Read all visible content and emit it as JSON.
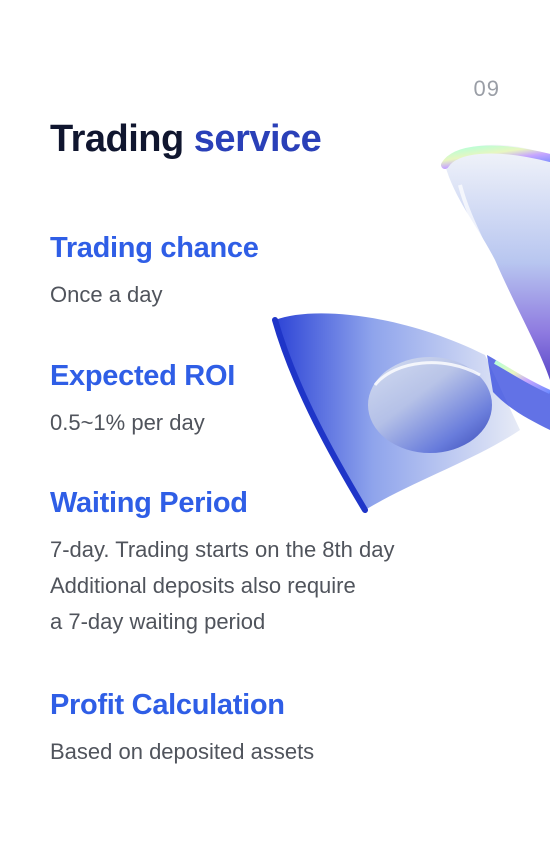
{
  "page_number": "09",
  "title": {
    "main": "Trading",
    "accent": "service"
  },
  "sections": [
    {
      "heading": "Trading chance",
      "lines": [
        "Once a day"
      ]
    },
    {
      "heading": "Expected ROI",
      "lines": [
        "0.5~1% per day"
      ]
    },
    {
      "heading": "Waiting Period",
      "lines": [
        "7-day. Trading starts on the 8th day",
        "Additional deposits also require",
        "a 7-day waiting period"
      ]
    },
    {
      "heading": "Profit Calculation",
      "lines": [
        "Based on deposited assets"
      ]
    }
  ],
  "colors": {
    "title": "#10162f",
    "accent": "#2a40b8",
    "heading": "#2f5ee6",
    "body": "#50545c",
    "page_number": "#9a9ea6"
  }
}
